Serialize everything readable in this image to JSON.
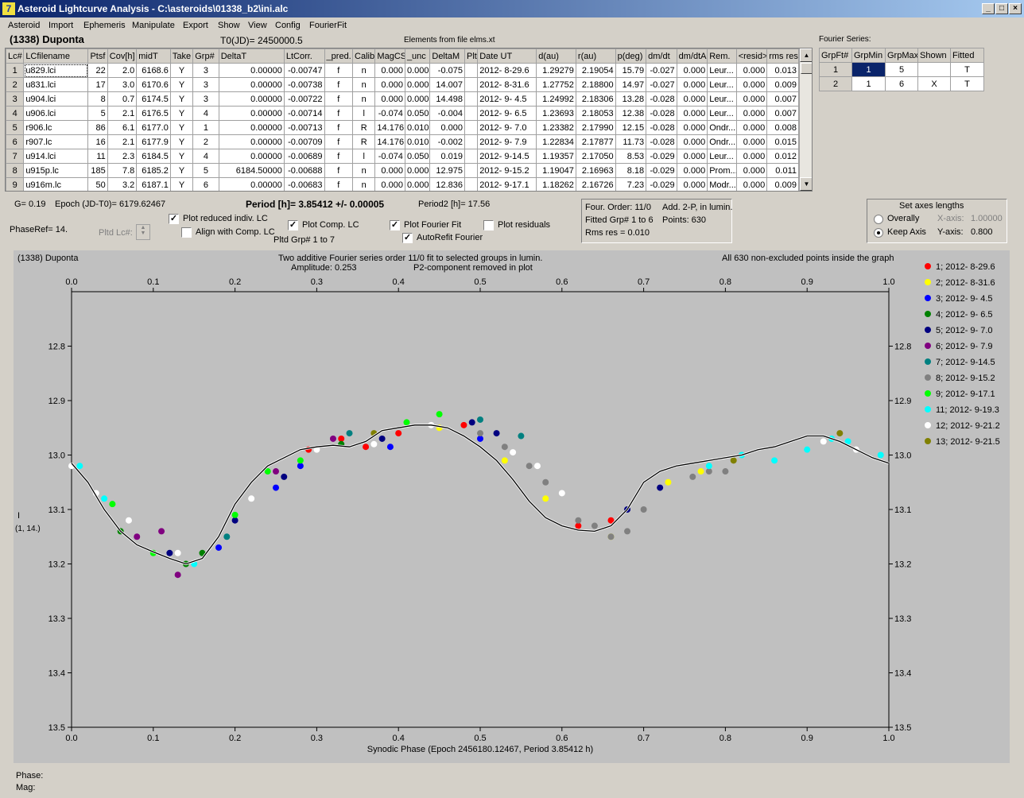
{
  "window": {
    "title": "Asteroid Lightcurve Analysis - C:\\asteroids\\01338_b2\\ini.alc",
    "icon": "app-icon",
    "min_label": "_",
    "max_label": "□",
    "close_label": "×"
  },
  "menu": [
    "Asteroid",
    "Import",
    "Ephemeris",
    "Manipulate",
    "Export",
    "Show",
    "View",
    "Config",
    "FourierFit"
  ],
  "header": {
    "asteroid": "(1338) Duponta",
    "t0": "T0(JD)= 2450000.5",
    "elements": "Elements from file elms.xt"
  },
  "lc_table": {
    "columns": [
      "Lc#",
      "LCfilename",
      "Ptsf",
      "Cov[h]",
      "midT",
      "Take",
      "Grp#",
      "DeltaT",
      "LtCorr.",
      "_pred.",
      "Calib.",
      "MagCS",
      "_unc",
      "DeltaM",
      "Plt",
      "Date UT",
      "d(au)",
      "r(au)",
      "p(deg)",
      "dm/dt",
      "dm/dtA",
      "Rem.",
      "<resid>",
      "rms res"
    ],
    "rows": [
      [
        "1",
        "u829.lci",
        "22",
        "2.0",
        "6168.6",
        "Y",
        "3",
        "0.00000",
        "-0.00747",
        "f",
        "n",
        "0.000",
        "0.000",
        "-0.075",
        "",
        "2012- 8-29.6",
        "1.29279",
        "2.19054",
        "15.79",
        "-0.027",
        "0.000",
        "Leur...",
        "0.000",
        "0.013"
      ],
      [
        "2",
        "u831.lci",
        "17",
        "3.0",
        "6170.6",
        "Y",
        "3",
        "0.00000",
        "-0.00738",
        "f",
        "n",
        "0.000",
        "0.000",
        "14.007",
        "",
        "2012- 8-31.6",
        "1.27752",
        "2.18800",
        "14.97",
        "-0.027",
        "0.000",
        "Leur...",
        "0.000",
        "0.009"
      ],
      [
        "3",
        "u904.lci",
        "8",
        "0.7",
        "6174.5",
        "Y",
        "3",
        "0.00000",
        "-0.00722",
        "f",
        "n",
        "0.000",
        "0.000",
        "14.498",
        "",
        "2012- 9- 4.5",
        "1.24992",
        "2.18306",
        "13.28",
        "-0.028",
        "0.000",
        "Leur...",
        "0.000",
        "0.007"
      ],
      [
        "4",
        "u906.lci",
        "5",
        "2.1",
        "6176.5",
        "Y",
        "4",
        "0.00000",
        "-0.00714",
        "f",
        "l",
        "-0.074",
        "0.050",
        "-0.004",
        "",
        "2012- 9- 6.5",
        "1.23693",
        "2.18053",
        "12.38",
        "-0.028",
        "0.000",
        "Leur...",
        "0.000",
        "0.007"
      ],
      [
        "5",
        "r906.lc",
        "86",
        "6.1",
        "6177.0",
        "Y",
        "1",
        "0.00000",
        "-0.00713",
        "f",
        "R",
        "14.176",
        "0.010",
        "0.000",
        "",
        "2012- 9- 7.0",
        "1.23382",
        "2.17990",
        "12.15",
        "-0.028",
        "0.000",
        "Ondr...",
        "0.000",
        "0.008"
      ],
      [
        "6",
        "r907.lc",
        "16",
        "2.1",
        "6177.9",
        "Y",
        "2",
        "0.00000",
        "-0.00709",
        "f",
        "R",
        "14.176",
        "0.010",
        "-0.002",
        "",
        "2012- 9- 7.9",
        "1.22834",
        "2.17877",
        "11.73",
        "-0.028",
        "0.000",
        "Ondr...",
        "0.000",
        "0.015"
      ],
      [
        "7",
        "u914.lci",
        "11",
        "2.3",
        "6184.5",
        "Y",
        "4",
        "0.00000",
        "-0.00689",
        "f",
        "l",
        "-0.074",
        "0.050",
        "0.019",
        "",
        "2012- 9-14.5",
        "1.19357",
        "2.17050",
        "8.53",
        "-0.029",
        "0.000",
        "Leur...",
        "0.000",
        "0.012"
      ],
      [
        "8",
        "u915p.lc",
        "185",
        "7.8",
        "6185.2",
        "Y",
        "5",
        "6184.50000",
        "-0.00688",
        "f",
        "n",
        "0.000",
        "0.000",
        "12.975",
        "",
        "2012- 9-15.2",
        "1.19047",
        "2.16963",
        "8.18",
        "-0.029",
        "0.000",
        "Prom...",
        "0.000",
        "0.011"
      ],
      [
        "9",
        "u916m.lc",
        "50",
        "3.2",
        "6187.1",
        "Y",
        "6",
        "0.00000",
        "-0.00683",
        "f",
        "n",
        "0.000",
        "0.000",
        "12.836",
        "",
        "2012- 9-17.1",
        "1.18262",
        "2.16726",
        "7.23",
        "-0.029",
        "0.000",
        "Modr...",
        "0.000",
        "0.009"
      ]
    ]
  },
  "fourier_series": {
    "title": "Fourier Series:",
    "columns": [
      "GrpFt#",
      "GrpMin",
      "GrpMax",
      "Shown",
      "Fitted"
    ],
    "rows": [
      [
        "1",
        "1",
        "5",
        "",
        "T"
      ],
      [
        "2",
        "1",
        "6",
        "X",
        "T"
      ]
    ]
  },
  "controls": {
    "g": "G= 0.19",
    "epoch": "Epoch (JD-T0)= 6179.62467",
    "period": "Period [h]= 3.85412 +/- 0.00005",
    "period2": "Period2 [h]= 17.56",
    "phaseref": "PhaseRef= 14.",
    "pltd_lc": "Pltd Lc#:",
    "plot_reduced": "Plot reduced indiv. LC",
    "align_comp": "Align with Comp. LC",
    "plot_comp": "Plot Comp. LC",
    "pltd_grp": "Pltd Grp#  1   to   7",
    "plot_fourier": "Plot Fourier Fit",
    "autorefit": "AutoRefit Fourier",
    "plot_residuals": "Plot residuals",
    "four_order": "Four. Order: 11/0",
    "add_2p": "Add. 2-P, in lumin.",
    "fitted_grp": "Fitted Grp# 1 to 6",
    "points": "Points: 630",
    "rms_res": "Rms res     = 0.010",
    "axes_title": "Set axes lengths",
    "overally": "Overally",
    "keep_axis": "Keep Axis",
    "x_axis_label": "X-axis:",
    "x_axis_value": "1.00000",
    "y_axis_label": "Y-axis:",
    "y_axis_value": "0.800"
  },
  "plot_header": {
    "name": "(1338) Duponta",
    "fit_desc": "Two additive Fourier series order 11/0 fit to selected groups in lumin.",
    "amplitude": "Amplitude: 0.253",
    "p2": "P2-component removed in plot",
    "points_note": "All 630 non-excluded points inside the graph"
  },
  "status": {
    "phase": "Phase:",
    "mag": "Mag:"
  },
  "chart_data": {
    "type": "scatter",
    "title": "",
    "xlabel": "Synodic Phase (Epoch 2456180.12467, Period 3.85412 h)",
    "ylabel": "I",
    "ylabel_sub": "(1, 14.)",
    "xlim": [
      0.0,
      1.0
    ],
    "ylim": [
      12.7,
      13.5
    ],
    "y_inverted": true,
    "xticks": [
      "0.0",
      "0.1",
      "0.2",
      "0.3",
      "0.4",
      "0.5",
      "0.6",
      "0.7",
      "0.8",
      "0.9",
      "1.0"
    ],
    "yticks": [
      "12.8",
      "12.9",
      "13.0",
      "13.1",
      "13.2",
      "13.3",
      "13.4",
      "13.5"
    ],
    "grid": false,
    "legend_position": "right",
    "fit_curve": {
      "color": "#000000",
      "x": [
        0.0,
        0.02,
        0.04,
        0.06,
        0.08,
        0.1,
        0.12,
        0.14,
        0.16,
        0.18,
        0.2,
        0.22,
        0.24,
        0.26,
        0.28,
        0.3,
        0.32,
        0.34,
        0.36,
        0.38,
        0.4,
        0.42,
        0.44,
        0.46,
        0.48,
        0.5,
        0.52,
        0.54,
        0.56,
        0.58,
        0.6,
        0.62,
        0.64,
        0.66,
        0.68,
        0.7,
        0.72,
        0.74,
        0.76,
        0.78,
        0.8,
        0.82,
        0.84,
        0.86,
        0.88,
        0.9,
        0.92,
        0.94,
        0.96,
        0.98,
        1.0
      ],
      "y": [
        13.015,
        13.05,
        13.1,
        13.14,
        13.165,
        13.178,
        13.19,
        13.2,
        13.19,
        13.15,
        13.09,
        13.05,
        13.02,
        13.005,
        12.99,
        12.985,
        12.982,
        12.985,
        12.975,
        12.955,
        12.95,
        12.945,
        12.945,
        12.95,
        12.965,
        12.985,
        13.01,
        13.045,
        13.085,
        13.115,
        13.13,
        13.138,
        13.14,
        13.13,
        13.1,
        13.05,
        13.03,
        13.02,
        13.015,
        13.01,
        13.005,
        13.0,
        12.99,
        12.985,
        12.975,
        12.965,
        12.965,
        12.975,
        12.99,
        13.005,
        13.015
      ]
    },
    "series": [
      {
        "name": "1; 2012- 8-29.6",
        "color": "#ff0000",
        "x": [
          0.29,
          0.33,
          0.36,
          0.4,
          0.48,
          0.62,
          0.66
        ],
        "y": [
          12.99,
          12.97,
          12.985,
          12.96,
          12.945,
          13.13,
          13.12
        ]
      },
      {
        "name": "2; 2012- 8-31.6",
        "color": "#ffff00",
        "x": [
          0.45,
          0.53,
          0.58,
          0.66,
          0.73,
          0.77
        ],
        "y": [
          12.95,
          13.01,
          13.08,
          13.15,
          13.05,
          13.03
        ]
      },
      {
        "name": "3; 2012- 9- 4.5",
        "color": "#0000ff",
        "x": [
          0.18,
          0.25,
          0.28,
          0.39,
          0.5
        ],
        "y": [
          13.17,
          13.06,
          13.02,
          12.985,
          12.97
        ]
      },
      {
        "name": "4; 2012- 9- 6.5",
        "color": "#008000",
        "x": [
          0.06,
          0.14,
          0.16,
          0.33
        ],
        "y": [
          13.14,
          13.2,
          13.18,
          12.98
        ]
      },
      {
        "name": "5; 2012- 9- 7.0",
        "color": "#000080",
        "x": [
          0.12,
          0.2,
          0.26,
          0.38,
          0.49,
          0.52,
          0.68,
          0.72
        ],
        "y": [
          13.18,
          13.12,
          13.04,
          12.97,
          12.94,
          12.96,
          13.1,
          13.06
        ]
      },
      {
        "name": "6; 2012- 9- 7.9",
        "color": "#800080",
        "x": [
          0.08,
          0.11,
          0.13,
          0.25,
          0.32
        ],
        "y": [
          13.15,
          13.14,
          13.22,
          13.03,
          12.97
        ]
      },
      {
        "name": "7; 2012- 9-14.5",
        "color": "#008080",
        "x": [
          0.19,
          0.34,
          0.5,
          0.55
        ],
        "y": [
          13.15,
          12.96,
          12.935,
          12.965
        ]
      },
      {
        "name": "8; 2012- 9-15.2",
        "color": "#808080",
        "x": [
          0.5,
          0.53,
          0.56,
          0.58,
          0.62,
          0.64,
          0.66,
          0.68,
          0.7,
          0.76,
          0.78,
          0.8
        ],
        "y": [
          12.96,
          12.985,
          13.02,
          13.05,
          13.12,
          13.13,
          13.15,
          13.14,
          13.1,
          13.04,
          13.03,
          13.03
        ]
      },
      {
        "name": "9; 2012- 9-17.1",
        "color": "#00ff00",
        "x": [
          0.05,
          0.1,
          0.2,
          0.24,
          0.28,
          0.41,
          0.45
        ],
        "y": [
          13.09,
          13.18,
          13.11,
          13.03,
          13.01,
          12.94,
          12.925
        ]
      },
      {
        "name": "11; 2012- 9-19.3",
        "color": "#00ffff",
        "x": [
          0.01,
          0.04,
          0.15,
          0.78,
          0.82,
          0.86,
          0.9,
          0.93,
          0.95,
          0.99
        ],
        "y": [
          13.02,
          13.08,
          13.2,
          13.02,
          13.0,
          13.01,
          12.99,
          12.97,
          12.975,
          13.0
        ]
      },
      {
        "name": "12; 2012- 9-21.2",
        "color": "#ffffff",
        "x": [
          0.0,
          0.03,
          0.07,
          0.13,
          0.22,
          0.3,
          0.37,
          0.44,
          0.54,
          0.57,
          0.6,
          0.92,
          0.96
        ],
        "y": [
          13.02,
          13.07,
          13.12,
          13.18,
          13.08,
          12.99,
          12.98,
          12.945,
          12.995,
          13.02,
          13.07,
          12.975,
          12.99
        ]
      },
      {
        "name": "13; 2012- 9-21.5",
        "color": "#808000",
        "x": [
          0.37,
          0.81,
          0.94
        ],
        "y": [
          12.96,
          13.01,
          12.96
        ]
      }
    ]
  }
}
